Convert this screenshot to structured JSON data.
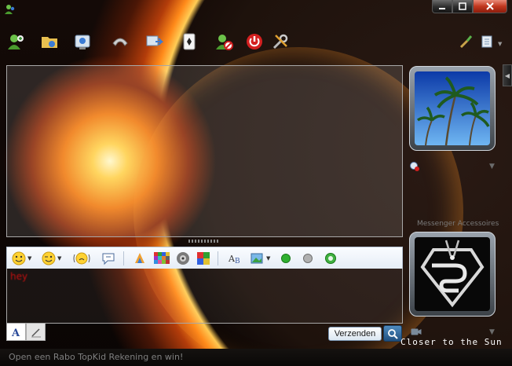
{
  "window": {
    "title": "",
    "subtitle": "",
    "buttons": {
      "minimize": "minimize",
      "maximize": "maximize",
      "close": "close"
    }
  },
  "toolbar": {
    "items": [
      {
        "icon": "invite-contact-icon"
      },
      {
        "icon": "send-files-icon"
      },
      {
        "icon": "webcam-icon"
      },
      {
        "icon": "call-icon"
      },
      {
        "icon": "activities-icon"
      },
      {
        "icon": "games-icon"
      },
      {
        "icon": "block-contact-icon"
      },
      {
        "icon": "disconnect-icon"
      },
      {
        "icon": "tools-icon"
      }
    ],
    "right": [
      {
        "icon": "paint-brush-icon"
      },
      {
        "icon": "menu-icon"
      }
    ]
  },
  "format_bar": {
    "items": [
      {
        "icon": "smiley-icon",
        "dropdown": true
      },
      {
        "icon": "wink-icon",
        "dropdown": true
      },
      {
        "icon": "nudge-icon"
      },
      {
        "icon": "voice-clip-icon"
      },
      {
        "icon": "wallpaper-icon"
      },
      {
        "icon": "color-grid-icon"
      },
      {
        "icon": "sound-icon"
      },
      {
        "icon": "puzzle-icon"
      },
      {
        "icon": "font-icon"
      },
      {
        "icon": "image-icon",
        "dropdown": true
      },
      {
        "icon": "green-dot-icon"
      },
      {
        "icon": "gray-dot-icon"
      },
      {
        "icon": "settings-dot-icon"
      }
    ]
  },
  "compose": {
    "text": "hey"
  },
  "send_button": {
    "label": "Verzenden"
  },
  "right_panel": {
    "accessories_label": "Messenger Accessoires"
  },
  "now_playing": {
    "text": "Closer to the Sun"
  },
  "ad_bar": {
    "text": "Open een Rabo TopKid Rekening en win!"
  },
  "colors": {
    "sun": "#ffd04a",
    "planet_rim": "#ff8a1a",
    "close_button": "#c2381f",
    "compose_text": "#c01010",
    "send_border": "#7a95b3"
  }
}
